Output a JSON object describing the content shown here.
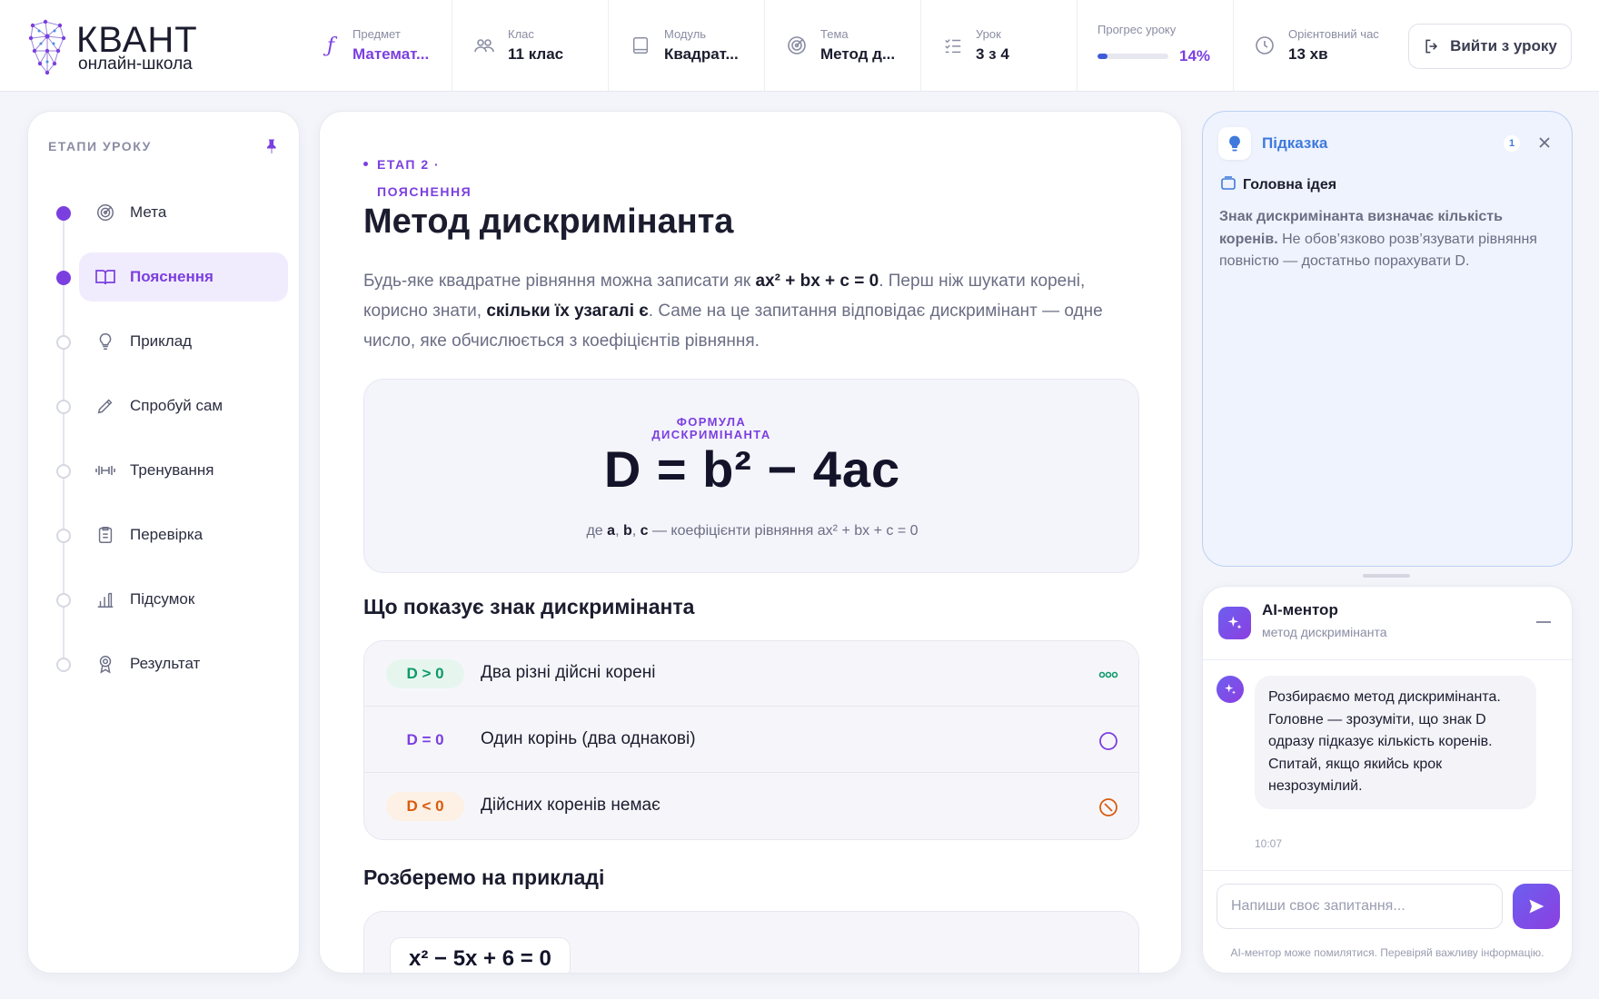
{
  "brand": {
    "title": "КВАНТ",
    "subtitle": "онлайн-школа"
  },
  "topbar": {
    "subject": {
      "label": "Предмет",
      "value": "Математ..."
    },
    "grade": {
      "label": "Клас",
      "value": "11 клас"
    },
    "module": {
      "label": "Модуль",
      "value": "Квадрат..."
    },
    "topic": {
      "label": "Тема",
      "value": "Метод д..."
    },
    "lesson": {
      "label": "Урок",
      "value": "3 з 4"
    },
    "progress": {
      "label": "Прогрес уроку",
      "percent_text": "14%",
      "fraction": 0.14
    },
    "time": {
      "label": "Орієнтовний час",
      "value": "13 хв"
    },
    "exit_label": "Вийти з уроку"
  },
  "sidebar": {
    "title": "ЕТАПИ УРОКУ",
    "steps": [
      {
        "label": "Мета",
        "icon": "target-icon",
        "state": "done"
      },
      {
        "label": "Пояснення",
        "icon": "book-icon",
        "state": "active"
      },
      {
        "label": "Приклад",
        "icon": "lightbulb-icon",
        "state": "pending"
      },
      {
        "label": "Спробуй сам",
        "icon": "pencil-icon",
        "state": "pending"
      },
      {
        "label": "Тренування",
        "icon": "dumbbell-icon",
        "state": "pending"
      },
      {
        "label": "Перевірка",
        "icon": "clipboard-icon",
        "state": "pending"
      },
      {
        "label": "Підсумок",
        "icon": "bar-chart-icon",
        "state": "pending"
      },
      {
        "label": "Результат",
        "icon": "award-icon",
        "state": "pending"
      }
    ]
  },
  "main": {
    "stage_tag": "ЕТАП 2 ·",
    "stage_sub": "ПОЯСНЕННЯ",
    "title": "Метод дискримінанта",
    "intro": {
      "p1": "Будь-яке квадратне рівняння можна записати як ",
      "p1_bold": "ax² + bx + c = 0",
      "p2": ". Перш ніж шукати корені, корисно знати, ",
      "p2_bold": "скільки їх узагалі є",
      "p3": ". Саме на це запитання відповідає дискримінант — одне число, яке обчислюється з коефіцієнтів рівняння."
    },
    "formula": {
      "label_line1": "ФОРМУЛА",
      "label_line2": "ДИСКРИМІНАНТА",
      "expression": "D = b² − 4ac",
      "note_prefix": "де ",
      "note_a": "a",
      "note_sep1": ", ",
      "note_b": "b",
      "note_sep2": ", ",
      "note_c": "c",
      "note_suffix": " — коефіцієнти рівняння ax² + bx + c = 0"
    },
    "sign_section_title": "Що показує знак дискримінанта",
    "signs": [
      {
        "badge": "D > 0",
        "text": "Два різні дійсні корені",
        "color": "#0f9a6b",
        "badge_bg": "#e6f6ef",
        "icon": "three-dots-icon"
      },
      {
        "badge": "D = 0",
        "text": "Один корінь (два однакові)",
        "color": "#7b3fe0",
        "badge_bg": "#f6f6fa",
        "icon": "circle-icon"
      },
      {
        "badge": "D < 0",
        "text": "Дійсних коренів немає",
        "color": "#d95b0e",
        "badge_bg": "#fdf0e4",
        "icon": "prohibited-icon"
      }
    ],
    "example_section_title": "Розберемо на прикладі",
    "example_equation": "x² − 5x + 6 = 0"
  },
  "hint": {
    "title": "Підказка",
    "count": "1",
    "subheading": "Головна ідея",
    "body_bold": "Знак дискримінанта визначає кількість коренів.",
    "body": " Не обов’язково розв’язувати рівняння повністю — достатньо порахувати D."
  },
  "mentor": {
    "title": "AI-ментор",
    "subtitle": "метод дискримінанта",
    "message": "Розбираємо метод дискримінанта. Головне — зрозуміти, що знак D одразу підказує кількість коренів. Спитай, якщо якийсь крок незрозумілий.",
    "time": "10:07",
    "input_placeholder": "Напиши своє запитання...",
    "disclaimer": "AI-ментор може помилятися. Перевіряй важливу інформацію."
  },
  "colors": {
    "accent": "#7b3fe0",
    "hint_blue": "#3f79dc",
    "progress_blue": "#3d5bd9"
  }
}
